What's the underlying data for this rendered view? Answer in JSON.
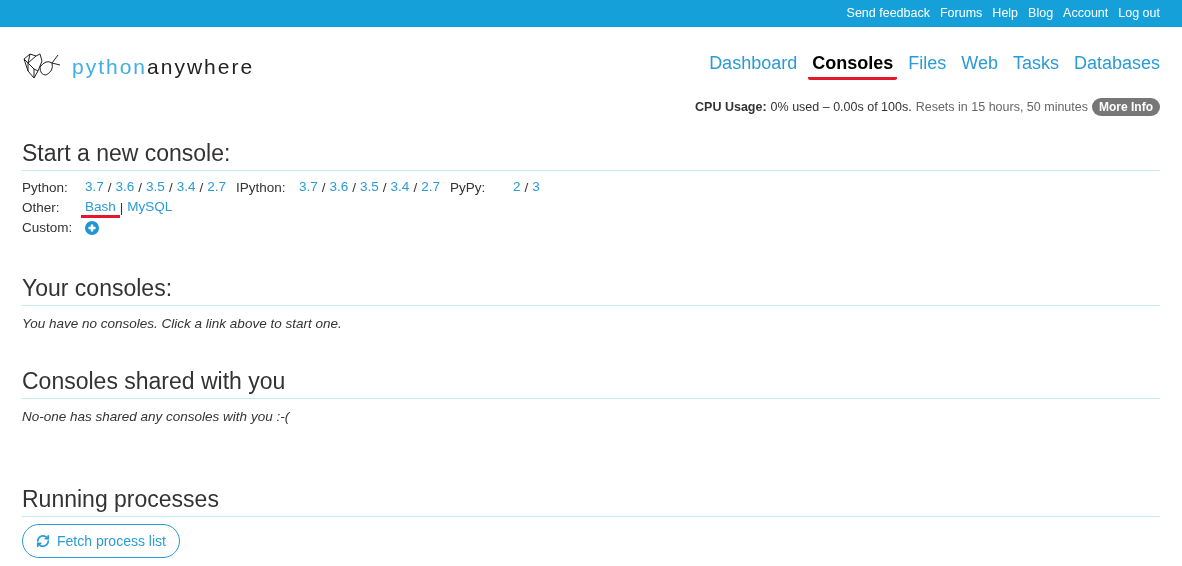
{
  "top_links": [
    "Send feedback",
    "Forums",
    "Help",
    "Blog",
    "Account",
    "Log out"
  ],
  "logo": {
    "first": "python",
    "second": "anywhere"
  },
  "nav": [
    {
      "label": "Dashboard",
      "selected": false,
      "underlined": false
    },
    {
      "label": "Consoles",
      "selected": true,
      "underlined": true
    },
    {
      "label": "Files",
      "selected": false,
      "underlined": false
    },
    {
      "label": "Web",
      "selected": false,
      "underlined": false
    },
    {
      "label": "Tasks",
      "selected": false,
      "underlined": false
    },
    {
      "label": "Databases",
      "selected": false,
      "underlined": false
    }
  ],
  "cpu": {
    "label": "CPU Usage:",
    "usage": "0% used – 0.00s of 100s.",
    "resets": "Resets in 15 hours, 50 minutes",
    "button": "More Info"
  },
  "start": {
    "title": "Start a new console:",
    "rows": [
      {
        "kind": "links",
        "groups": [
          {
            "label": "Python:",
            "separator": "/",
            "links": [
              {
                "text": "3.7",
                "underlined": false
              },
              {
                "text": "3.6",
                "underlined": false
              },
              {
                "text": "3.5",
                "underlined": false
              },
              {
                "text": "3.4",
                "underlined": false
              },
              {
                "text": "2.7",
                "underlined": false
              }
            ]
          },
          {
            "label": "IPython:",
            "separator": "/",
            "links": [
              {
                "text": "3.7",
                "underlined": false
              },
              {
                "text": "3.6",
                "underlined": false
              },
              {
                "text": "3.5",
                "underlined": false
              },
              {
                "text": "3.4",
                "underlined": false
              },
              {
                "text": "2.7",
                "underlined": false
              }
            ]
          },
          {
            "label": "PyPy:",
            "separator": "/",
            "links": [
              {
                "text": "2",
                "underlined": false
              },
              {
                "text": "3",
                "underlined": false
              }
            ]
          }
        ]
      },
      {
        "kind": "links",
        "groups": [
          {
            "label": "Other:",
            "separator": "|",
            "links": [
              {
                "text": "Bash",
                "underlined": true
              },
              {
                "text": "MySQL",
                "underlined": false
              }
            ]
          }
        ]
      },
      {
        "kind": "add",
        "label": "Custom:"
      }
    ]
  },
  "your_consoles": {
    "title": "Your consoles:",
    "message": "You have no consoles. Click a link above to start one."
  },
  "shared": {
    "title": "Consoles shared with you",
    "message": "No-one has shared any consoles with you :-("
  },
  "processes": {
    "title": "Running processes",
    "button": "Fetch process list"
  }
}
